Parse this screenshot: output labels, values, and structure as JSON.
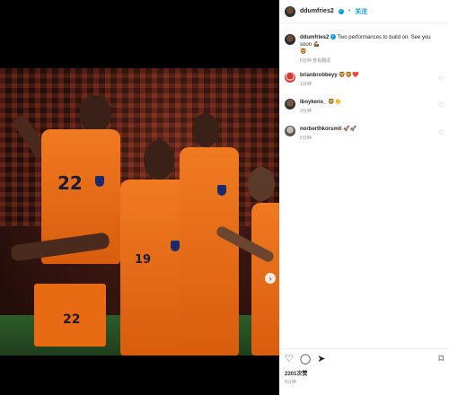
{
  "header": {
    "username": "ddumfries2",
    "verified_mark": "✓",
    "separator": "•",
    "follow_label": "关注"
  },
  "caption": {
    "username": "ddumfries2",
    "text": "Two performances to build on. See you soon 💪🏾",
    "emoji_extra": "🦁",
    "time": "6分钟",
    "translate": "查看翻译"
  },
  "comments": [
    {
      "username": "brianbrobbeyy",
      "text": "🦁🦁❤️",
      "time": "1分钟",
      "avatar": "red-white-avatar"
    },
    {
      "username": "lboykens_",
      "text": "🦁👏",
      "time": "2分钟",
      "avatar": "dark-avatar"
    },
    {
      "username": "norberthkorsmit",
      "text": "🚀🚀",
      "time": "5分钟",
      "avatar": "grey-avatar"
    }
  ],
  "post": {
    "likes": "2201次赞",
    "time": "6分钟",
    "jersey_numbers": [
      "22",
      "19",
      "22"
    ]
  },
  "icons": {
    "like": "heart-icon",
    "comment": "comment-icon",
    "share": "share-icon",
    "save": "bookmark-icon",
    "next": "chevron-right-icon"
  },
  "colors": {
    "accent": "#0095f6",
    "jersey": "#f07a22"
  }
}
